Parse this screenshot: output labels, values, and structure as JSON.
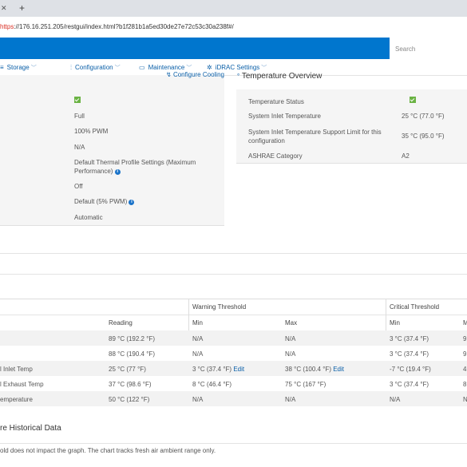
{
  "browser": {
    "close_glyph": "✕",
    "newtab_glyph": "+",
    "url_scheme": "https",
    "url_rest": "://176.16.251.205/restgui/index.html?b1f281b1a5ed30de27e72c53c30a238f#/"
  },
  "header": {
    "search_placeholder": "Search",
    "accent_color": "#0076ce"
  },
  "nav": {
    "storage": "Storage",
    "configuration": "Configuration",
    "maintenance": "Maintenance",
    "idrac_settings": "iDRAC Settings"
  },
  "cooling": {
    "configure_link": "Configure Cooling",
    "values": [
      "Full",
      "100% PWM",
      "N/A",
      "Default Thermal Profile Settings (Maximum Performance)",
      "Off",
      "Default (5% PWM)",
      "Automatic"
    ]
  },
  "temperature_overview": {
    "title": "Temperature Overview",
    "rows": [
      {
        "label": "Temperature Status",
        "value": ""
      },
      {
        "label": "System Inlet Temperature",
        "value": "25 °C (77.0 °F)"
      },
      {
        "label": "System Inlet Temperature Support Limit for this configuration",
        "value": "35 °C (95.0 °F)"
      },
      {
        "label": "ASHRAE Category",
        "value": "A2"
      }
    ]
  },
  "probes_table": {
    "group_headers": {
      "warning": "Warning Threshold",
      "critical": "Critical Threshold"
    },
    "col_headers": {
      "reading": "Reading",
      "warn_min": "Min",
      "warn_max": "Max",
      "crit_min": "Min",
      "crit_max_partial": "M"
    },
    "rows": [
      {
        "name": "",
        "reading": "89 °C (192.2 °F)",
        "warn_min": "N/A",
        "warn_max": "N/A",
        "crit_min": "3 °C (37.4 °F)",
        "crit_max": "9"
      },
      {
        "name": "",
        "reading": "88 °C (190.4 °F)",
        "warn_min": "N/A",
        "warn_max": "N/A",
        "crit_min": "3 °C (37.4 °F)",
        "crit_max": "9"
      },
      {
        "name": "l Inlet Temp",
        "reading": "25 °C (77 °F)",
        "warn_min": "3 °C (37.4 °F)",
        "warn_min_edit": "Edit",
        "warn_max": "38 °C (100.4 °F)",
        "warn_max_edit": "Edit",
        "crit_min": "-7 °C (19.4 °F)",
        "crit_max": "4"
      },
      {
        "name": "l Exhaust Temp",
        "reading": "37 °C (98.6 °F)",
        "warn_min": "8 °C (46.4 °F)",
        "warn_max": "75 °C (167 °F)",
        "crit_min": "3 °C (37.4 °F)",
        "crit_max": "8"
      },
      {
        "name": "emperature",
        "reading": "50 °C (122 °F)",
        "warn_min": "N/A",
        "warn_max": "N/A",
        "crit_min": "N/A",
        "crit_max": "N"
      }
    ]
  },
  "history": {
    "title": "re Historical Data",
    "note": "old does not impact the graph. The chart tracks fresh air ambient range only."
  }
}
